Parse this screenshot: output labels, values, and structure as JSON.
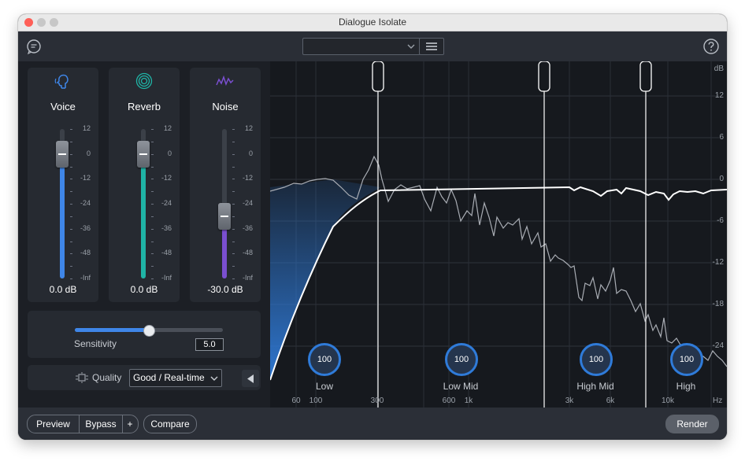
{
  "window": {
    "title": "Dialogue Isolate"
  },
  "toolbar": {
    "preset_value": ""
  },
  "modules": [
    {
      "name": "Voice",
      "value": "0.0 dB",
      "level_db": 0,
      "color": "#3f86e8"
    },
    {
      "name": "Reverb",
      "value": "0.0 dB",
      "level_db": 0,
      "color": "#1fb4a6"
    },
    {
      "name": "Noise",
      "value": "-30.0 dB",
      "level_db": -30,
      "color": "#7a4fd0"
    }
  ],
  "fader_scale": [
    "12",
    "0",
    "-12",
    "-24",
    "-36",
    "-48",
    "-Inf"
  ],
  "sensitivity": {
    "label": "Sensitivity",
    "value": "5.0",
    "fraction": 0.5
  },
  "quality": {
    "label": "Quality",
    "value": "Good / Real-time"
  },
  "bottom": {
    "preview": "Preview",
    "bypass": "Bypass",
    "plus": "+",
    "compare": "Compare",
    "render": "Render"
  },
  "graph": {
    "db_unit": "dB",
    "db_ticks": [
      "12",
      "6",
      "0",
      "-6",
      "-12",
      "-18",
      "-24"
    ],
    "hz_ticks": [
      "60",
      "100",
      "300",
      "600",
      "1k",
      "3k",
      "6k",
      "10k"
    ],
    "hz_unit": "Hz",
    "bands": [
      {
        "name": "Low",
        "value": "100"
      },
      {
        "name": "Low Mid",
        "value": "100"
      },
      {
        "name": "High Mid",
        "value": "100"
      },
      {
        "name": "High",
        "value": "100"
      }
    ]
  },
  "icons": [
    "voice-icon",
    "reverb-icon",
    "noise-icon",
    "chat-icon",
    "help-icon",
    "quality-icon",
    "collapse-icon",
    "chevron-down-icon",
    "menu-icon"
  ]
}
